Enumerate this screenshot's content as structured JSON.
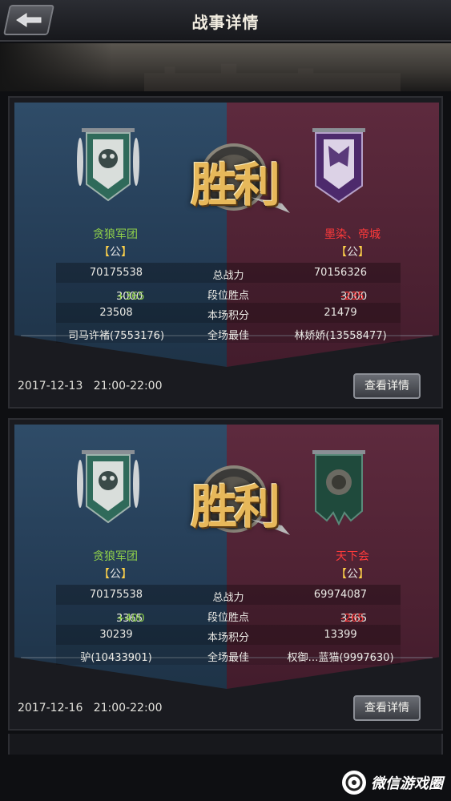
{
  "header": {
    "title": "战事详情",
    "back_icon": "back-arrow-icon"
  },
  "colors": {
    "win_green": "#8fd04a",
    "loss_red": "#ff3a3a",
    "blue_side": "#2f4c68",
    "red_side": "#5e2a3e"
  },
  "battles": [
    {
      "result_text": "胜利",
      "left": {
        "name": "贪狼军团",
        "tag": "公",
        "banner_icon": "white-war-banner-icon"
      },
      "right": {
        "name": "墨染、帝城",
        "tag": "公",
        "banner_icon": "purple-war-banner-icon"
      },
      "stats": [
        {
          "left": "70175538",
          "label": "总战力",
          "right": "70156326"
        },
        {
          "left_base": "3000",
          "left_delta": "+365",
          "label": "段位胜点",
          "right_base": "3000",
          "right_delta": "-235"
        },
        {
          "left": "23508",
          "label": "本场积分",
          "right": "21479"
        },
        {
          "left": "司马许褚(7553176)",
          "label": "全场最佳",
          "right": "林娇娇(13558477)"
        }
      ],
      "date": "2017-12-13",
      "time": "21:00-22:00",
      "detail_button": "查看详情"
    },
    {
      "result_text": "胜利",
      "left": {
        "name": "贪狼军团",
        "tag": "公",
        "banner_icon": "white-war-banner-icon"
      },
      "right": {
        "name": "天下会",
        "tag": "公",
        "banner_icon": "green-war-banner-icon"
      },
      "stats": [
        {
          "left": "70175538",
          "label": "总战力",
          "right": "69974087"
        },
        {
          "left_base": "3365",
          "left_delta": "+400",
          "label": "段位胜点",
          "right_base": "3365",
          "right_delta": "-265"
        },
        {
          "left": "30239",
          "label": "本场积分",
          "right": "13399"
        },
        {
          "left": "驴(10433901)",
          "label": "全场最佳",
          "right": "权御…蓝猫(9997630)"
        }
      ],
      "date": "2017-12-16",
      "time": "21:00-22:00",
      "detail_button": "查看详情"
    }
  ],
  "watermark": {
    "text": "微信游戏圈",
    "icon": "wechat-game-circle-icon"
  }
}
